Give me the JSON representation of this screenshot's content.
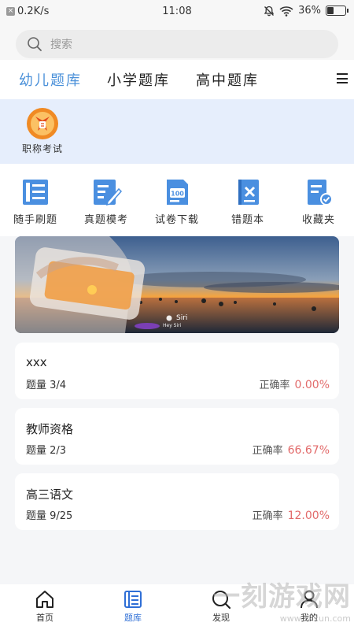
{
  "status": {
    "speed": "0.2K/s",
    "time": "11:08",
    "battery": "36%",
    "battery_level": 0.36
  },
  "search": {
    "placeholder": "搜索"
  },
  "tabs": [
    {
      "label": "幼儿题库",
      "active": true
    },
    {
      "label": "小学题库",
      "active": false
    },
    {
      "label": "高中题库",
      "active": false
    }
  ],
  "category": {
    "label": "职称考试"
  },
  "quick": [
    {
      "label": "随手刷题",
      "icon": "book-stack-icon"
    },
    {
      "label": "真题模考",
      "icon": "pen-paper-icon"
    },
    {
      "label": "试卷下载",
      "icon": "score-paper-icon"
    },
    {
      "label": "错题本",
      "icon": "error-book-icon"
    },
    {
      "label": "收藏夹",
      "icon": "favorites-icon"
    }
  ],
  "banner": {
    "caption": "Siri",
    "subcaption": "Hey Siri"
  },
  "banks": [
    {
      "title": "xxx",
      "count": "题量 3/4",
      "rate_label": "正确率",
      "rate": "0.00%"
    },
    {
      "title": "教师资格",
      "count": "题量 2/3",
      "rate_label": "正确率",
      "rate": "66.67%"
    },
    {
      "title": "高三语文",
      "count": "题量 9/25",
      "rate_label": "正确率",
      "rate": "12.00%"
    }
  ],
  "nav": [
    {
      "label": "首页",
      "icon": "home-icon"
    },
    {
      "label": "题库",
      "icon": "question-bank-icon",
      "active": true
    },
    {
      "label": "发现",
      "icon": "discover-icon"
    },
    {
      "label": "我的",
      "icon": "profile-icon"
    }
  ],
  "watermark": {
    "text": "一刻游戏网",
    "url": "www.1kxun.com"
  },
  "colors": {
    "accent": "#4a90d9",
    "rate_red": "#e26a6a",
    "category_band": "#e6eefc",
    "nav_active": "#2f6fd6"
  }
}
